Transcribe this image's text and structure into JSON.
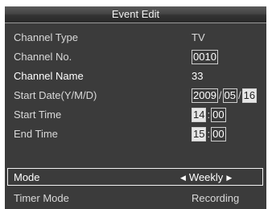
{
  "title": "Event Edit",
  "rows": {
    "channel_type": {
      "label": "Channel Type",
      "value": "TV"
    },
    "channel_no": {
      "label": "Channel No.",
      "value": "0010"
    },
    "channel_name": {
      "label": "Channel Name",
      "value": "33"
    },
    "start_date": {
      "label": "Start Date(Y/M/D)",
      "year": "2009",
      "month": "05",
      "day": "16"
    },
    "start_time": {
      "label": "Start Time",
      "hour": "14",
      "minute": "00"
    },
    "end_time": {
      "label": "End Time",
      "hour": "15",
      "minute": "00"
    },
    "mode": {
      "label": "Mode",
      "value": "Weekly",
      "left_arrow": "◀",
      "right_arrow": "▶"
    },
    "timer_mode": {
      "label": "Timer Mode",
      "value": "Recording"
    }
  },
  "separators": {
    "date": "/",
    "time": ":"
  }
}
